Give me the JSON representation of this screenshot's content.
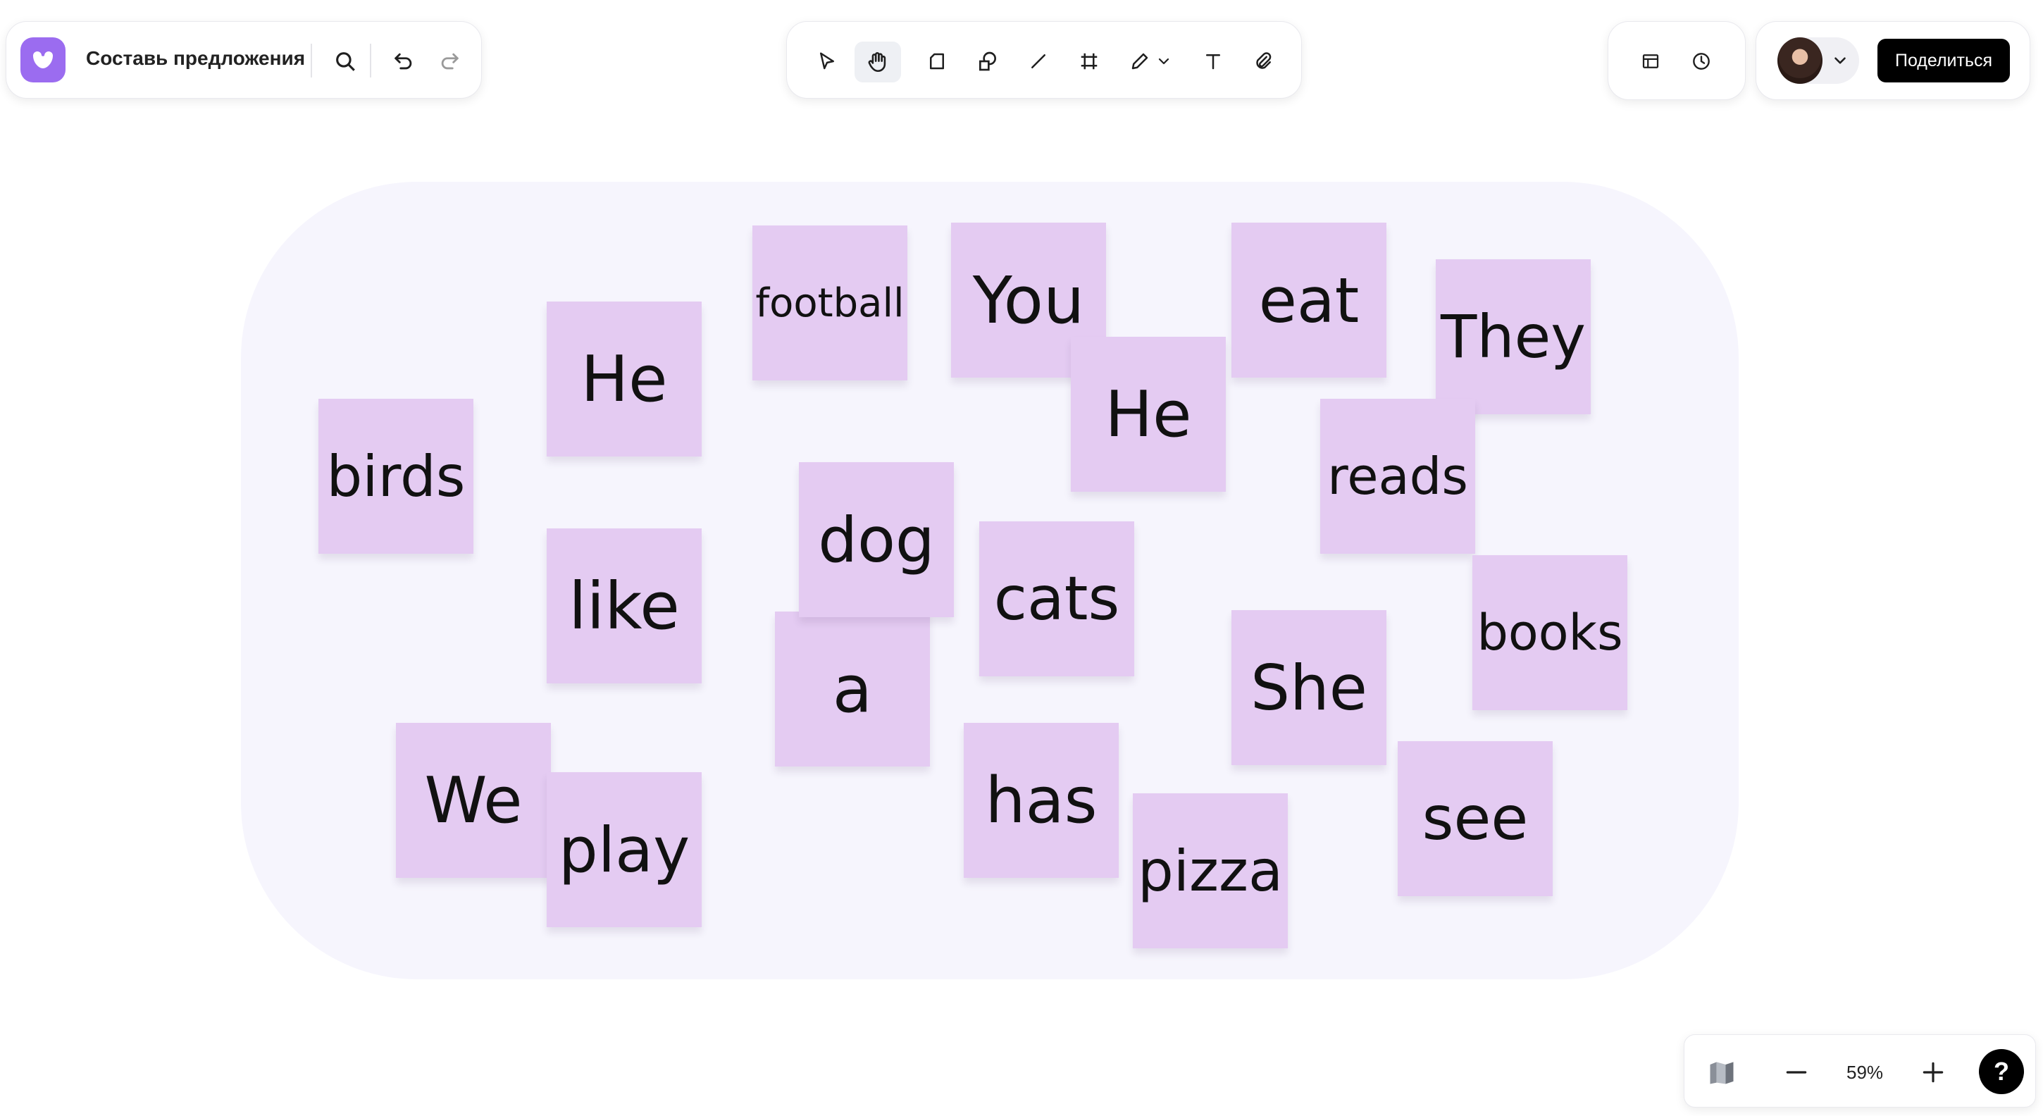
{
  "board": {
    "title": "Составь предложения"
  },
  "header": {
    "share_label": "Поделиться"
  },
  "zoom": {
    "level": "59%"
  },
  "help": {
    "label": "?"
  },
  "colors": {
    "accent": "#9b6cf0",
    "note": "#e4cbf2",
    "board_bg": "#f6f5fd",
    "share_bg": "#000000"
  },
  "icons": [
    "logo-icon",
    "search-icon",
    "undo-icon",
    "redo-icon",
    "cursor-icon",
    "hand-icon",
    "sticky-note-icon",
    "shapes-icon",
    "line-icon",
    "frame-icon",
    "pen-icon",
    "chevron-down-icon",
    "text-icon",
    "attachment-icon",
    "layout-icon",
    "history-icon",
    "avatar",
    "minimap-icon",
    "zoom-out-icon",
    "zoom-in-icon",
    "help-icon"
  ],
  "notes": [
    "football",
    "You",
    "eat",
    "They",
    "He",
    "He",
    "birds",
    "reads",
    "dog",
    "like",
    "cats",
    "books",
    "a",
    "She",
    "We",
    "play",
    "has",
    "pizza",
    "see"
  ]
}
